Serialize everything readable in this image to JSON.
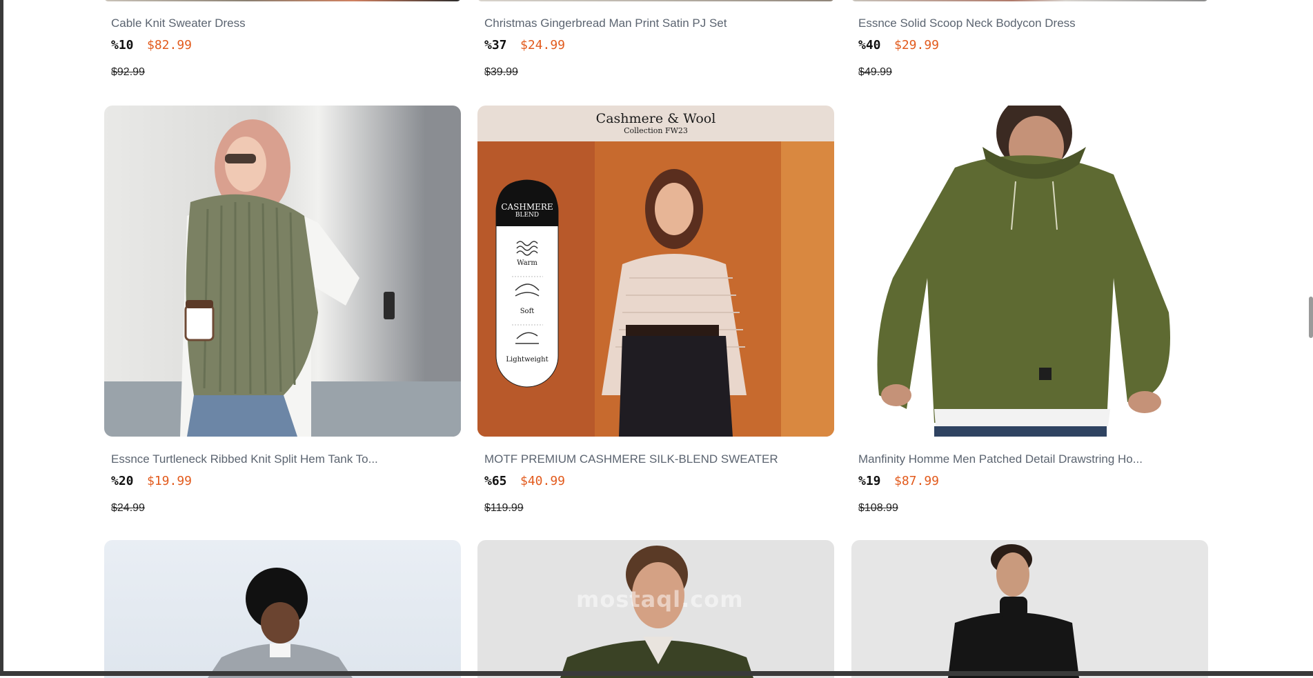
{
  "products": [
    {
      "title": "Cable Knit Sweater Dress",
      "discount": "%10",
      "price": "$82.99",
      "old_price": "$92.99"
    },
    {
      "title": "Christmas Gingerbread Man Print Satin PJ Set",
      "discount": "%37",
      "price": "$24.99",
      "old_price": "$39.99"
    },
    {
      "title": "Essnce Solid Scoop Neck Bodycon Dress",
      "discount": "%40",
      "price": "$29.99",
      "old_price": "$49.99"
    },
    {
      "title": "Essnce Turtleneck Ribbed Knit Split Hem Tank To...",
      "discount": "%20",
      "price": "$19.99",
      "old_price": "$24.99"
    },
    {
      "title": "MOTF PREMIUM CASHMERE SILK-BLEND SWEATER",
      "discount": "%65",
      "price": "$40.99",
      "old_price": "$119.99"
    },
    {
      "title": "Manfinity Homme Men Patched Detail Drawstring Ho...",
      "discount": "%19",
      "price": "$87.99",
      "old_price": "$108.99"
    }
  ],
  "cashmere_image": {
    "heading": "Cashmere & Wool",
    "subheading": "Collection FW23",
    "badge_line1": "CASHMERE",
    "badge_line2": "BLEND",
    "features": [
      "Warm",
      "Soft",
      "Lightweight"
    ]
  },
  "watermark": "mostaql.com",
  "colors": {
    "price": "#e25a1c",
    "title": "#5b6470",
    "discount": "#111111"
  }
}
